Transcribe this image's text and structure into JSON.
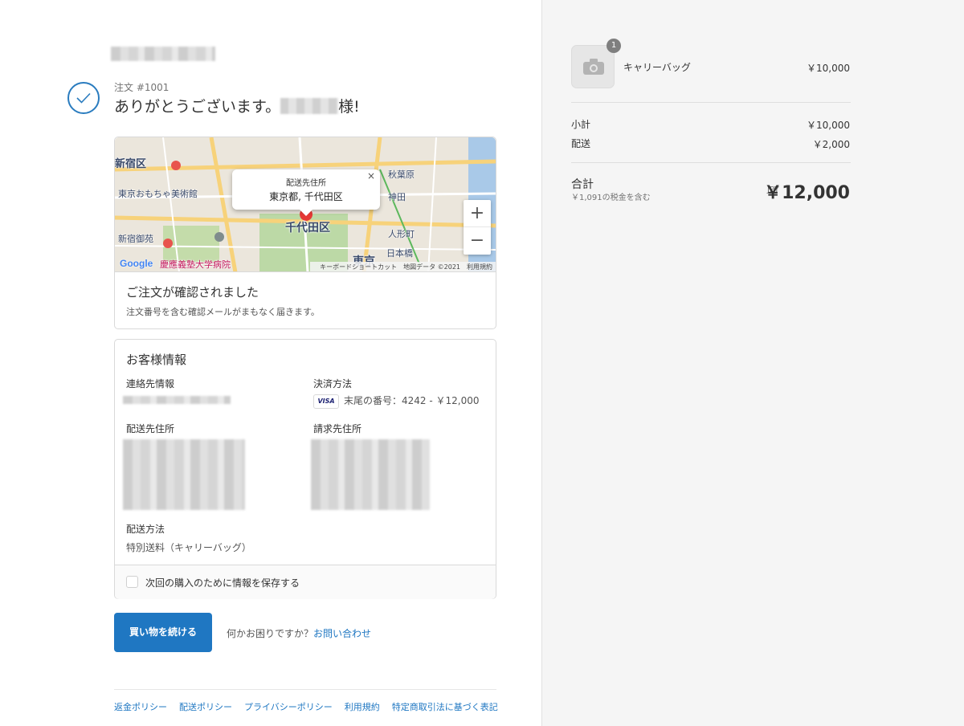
{
  "header": {
    "order_number": "注文 #1001",
    "thanks_prefix": "ありがとうございます。",
    "thanks_suffix": "様!"
  },
  "map": {
    "popup_title": "配送先住所",
    "popup_address": "東京都, 千代田区",
    "popup_close": "×",
    "zoom_in": "+",
    "zoom_out": "−",
    "logo": "Google",
    "attribution": {
      "shortcuts": "キーボードショートカット",
      "data": "地図データ ©2021",
      "terms": "利用規約"
    },
    "labels": {
      "shinjuku": "新宿区",
      "chiyoda": "千代田区",
      "toy_museum": "東京おもちゃ美術館",
      "shinjuku_gyoen": "新宿御苑",
      "keio_hospital": "慶應義塾大学病院",
      "kanda": "神田",
      "ningyocho": "人形町",
      "nihonbashi": "日本橋",
      "tokyo": "東京",
      "akihabara": "秋葉原"
    }
  },
  "confirmation": {
    "title": "ご注文が確認されました",
    "message": "注文番号を含む確認メールがまもなく届きます。"
  },
  "customer": {
    "title": "お客様情報",
    "contact_label": "連絡先情報",
    "payment_label": "決済方法",
    "card_brand": "VISA",
    "payment_value": "末尾の番号：4242 - ￥12,000",
    "shipping_address_label": "配送先住所",
    "billing_address_label": "請求先住所",
    "shipping_method_label": "配送方法",
    "shipping_method_value": "特別送料（キャリーバッグ）",
    "save_info_label": "次回の購入のために情報を保存する"
  },
  "actions": {
    "continue_label": "買い物を続ける",
    "help_text": "何かお困りですか？",
    "help_link": "お問い合わせ"
  },
  "footer": {
    "links": [
      "返金ポリシー",
      "配送ポリシー",
      "プライバシーポリシー",
      "利用規約",
      "特定商取引法に基づく表記"
    ]
  },
  "summary": {
    "item_name": "キャリーバッグ",
    "item_quantity": "1",
    "item_price": "￥10,000",
    "subtotal_label": "小計",
    "subtotal_value": "￥10,000",
    "shipping_label": "配送",
    "shipping_value": "￥2,000",
    "total_label": "合計",
    "tax_note": "￥1,091の税金を含む",
    "currency": "JPY",
    "total_value": "￥12,000"
  },
  "colors": {
    "accent": "#1f77c2",
    "check": "#2a7cbf",
    "summary_bg": "#f5f5f5"
  }
}
